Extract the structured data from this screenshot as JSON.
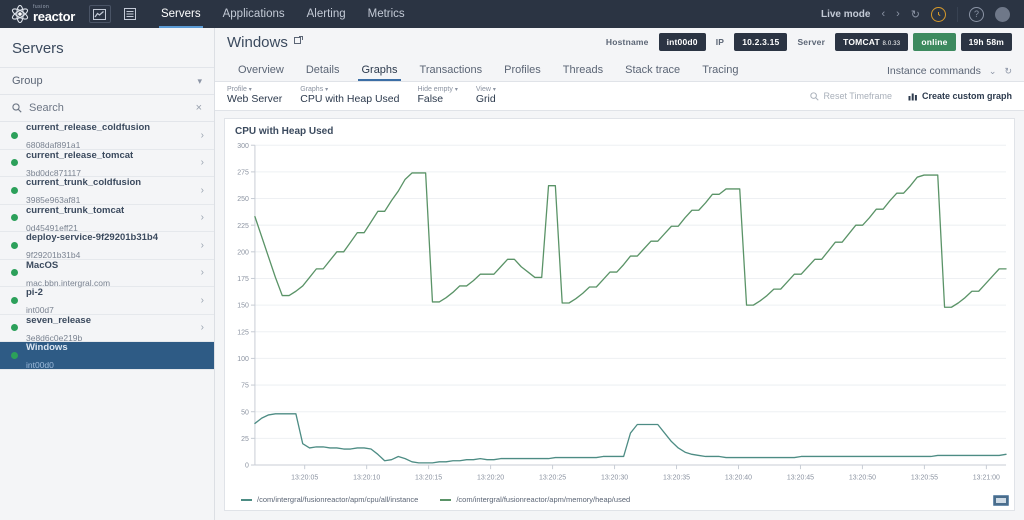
{
  "topnav": {
    "logo_fusion": "fusion",
    "logo_reactor": "reactor",
    "links": [
      {
        "label": "Servers",
        "active": true
      },
      {
        "label": "Applications",
        "active": false
      },
      {
        "label": "Alerting",
        "active": false
      },
      {
        "label": "Metrics",
        "active": false
      }
    ],
    "live_mode": "Live mode",
    "prev": "‹",
    "next": "›",
    "refresh": "↻",
    "clock": "◴",
    "help": "?"
  },
  "sidebar": {
    "title": "Servers",
    "group_label": "Group",
    "search_placeholder": "Search",
    "clear": "×",
    "chevron": "›",
    "items": [
      {
        "name": "current_release_coldfusion",
        "id": "6808daf891a1",
        "selected": false
      },
      {
        "name": "current_release_tomcat",
        "id": "3bd0dc871117",
        "selected": false
      },
      {
        "name": "current_trunk_coldfusion",
        "id": "3985e963af81",
        "selected": false
      },
      {
        "name": "current_trunk_tomcat",
        "id": "0d45491eff21",
        "selected": false
      },
      {
        "name": "deploy-service-9f29201b31b4",
        "id": "9f29201b31b4",
        "selected": false
      },
      {
        "name": "MacOS",
        "id": "mac.bbn.intergral.com",
        "selected": false
      },
      {
        "name": "pi-2",
        "id": "int00d7",
        "selected": false
      },
      {
        "name": "seven_release",
        "id": "3e8d6c0e219b",
        "selected": false
      },
      {
        "name": "Windows",
        "id": "int00d0",
        "selected": true
      }
    ]
  },
  "header": {
    "title": "Windows",
    "external_icon": "⧉",
    "hostname_label": "Hostname",
    "hostname_value": "int00d0",
    "ip_label": "IP",
    "ip_value": "10.2.3.15",
    "server_label": "Server",
    "server_value": "TOMCAT",
    "server_version": "8.0.33",
    "status": "online",
    "uptime": "19h 58m"
  },
  "tabs": [
    {
      "label": "Overview",
      "active": false
    },
    {
      "label": "Details",
      "active": false
    },
    {
      "label": "Graphs",
      "active": true
    },
    {
      "label": "Transactions",
      "active": false
    },
    {
      "label": "Profiles",
      "active": false
    },
    {
      "label": "Threads",
      "active": false
    },
    {
      "label": "Stack trace",
      "active": false
    },
    {
      "label": "Tracing",
      "active": false
    }
  ],
  "instance_commands": {
    "label": "Instance commands",
    "chevron": "⌄",
    "refresh": "↻"
  },
  "toolbar": {
    "groups": [
      {
        "label": "Profile",
        "value": "Web Server"
      },
      {
        "label": "Graphs",
        "value": "CPU with Heap Used"
      },
      {
        "label": "Hide empty",
        "value": "False"
      },
      {
        "label": "View",
        "value": "Grid"
      }
    ],
    "caret": "▾",
    "reset_timeframe": "Reset Timeframe",
    "create_custom_graph": "Create custom graph"
  },
  "chart_data": {
    "type": "line",
    "title": "CPU with Heap Used",
    "xlabel": "",
    "ylabel": "",
    "ylim": [
      0,
      300
    ],
    "yticks": [
      0,
      25,
      50,
      75,
      100,
      125,
      150,
      175,
      200,
      225,
      250,
      275,
      300
    ],
    "grid": true,
    "legend_position": "bottom",
    "xticks": [
      "13:20:05",
      "13:20:10",
      "13:20:15",
      "13:20:20",
      "13:20:25",
      "13:20:30",
      "13:20:35",
      "13:20:40",
      "13:20:45",
      "13:20:50",
      "13:20:55",
      "13:21:00"
    ],
    "x_start": "13:20:03",
    "x_end": "13:21:02",
    "series": [
      {
        "name": "/com/intergral/fusionreactor/apm/memory/heap/used",
        "color": "#5a9367",
        "values": [
          233,
          214,
          195,
          176,
          159,
          159,
          163,
          168,
          176,
          184,
          184,
          192,
          200,
          200,
          209,
          218,
          218,
          228,
          238,
          238,
          248,
          257,
          268,
          274,
          274,
          274,
          153,
          153,
          157,
          162,
          168,
          168,
          173,
          179,
          179,
          179,
          186,
          193,
          193,
          186,
          181,
          176,
          176,
          262,
          262,
          152,
          152,
          156,
          161,
          167,
          167,
          174,
          181,
          181,
          188,
          196,
          196,
          203,
          210,
          210,
          217,
          224,
          224,
          232,
          239,
          239,
          246,
          254,
          254,
          259,
          259,
          259,
          150,
          150,
          154,
          159,
          165,
          165,
          172,
          179,
          179,
          186,
          193,
          193,
          201,
          209,
          209,
          217,
          225,
          225,
          232,
          240,
          240,
          248,
          255,
          255,
          262,
          270,
          272,
          272,
          272,
          148,
          148,
          152,
          157,
          163,
          163,
          170,
          177,
          184,
          184
        ]
      },
      {
        "name": "/com/intergral/fusionreactor/apm/cpu/all/instance",
        "color": "#4d8c84",
        "values": [
          39,
          44,
          47,
          48,
          48,
          48,
          48,
          20,
          16,
          17,
          17,
          16,
          16,
          15,
          15,
          16,
          16,
          15,
          10,
          4,
          5,
          8,
          6,
          3,
          2,
          2,
          2,
          3,
          3,
          4,
          4,
          5,
          5,
          6,
          5,
          5,
          6,
          6,
          6,
          6,
          6,
          6,
          6,
          6,
          7,
          7,
          7,
          7,
          7,
          7,
          7,
          8,
          8,
          8,
          8,
          30,
          38,
          38,
          38,
          38,
          30,
          22,
          16,
          12,
          10,
          9,
          8,
          8,
          8,
          7,
          7,
          7,
          7,
          7,
          7,
          7,
          7,
          7,
          7,
          7,
          8,
          8,
          8,
          8,
          8,
          8,
          8,
          8,
          8,
          8,
          8,
          8,
          8,
          8,
          8,
          8,
          8,
          8,
          8,
          8,
          9,
          9,
          9,
          9,
          9,
          9,
          9,
          9,
          9,
          9,
          10
        ]
      }
    ]
  },
  "chart_footer": {
    "expand_icon": "expand-icon"
  }
}
